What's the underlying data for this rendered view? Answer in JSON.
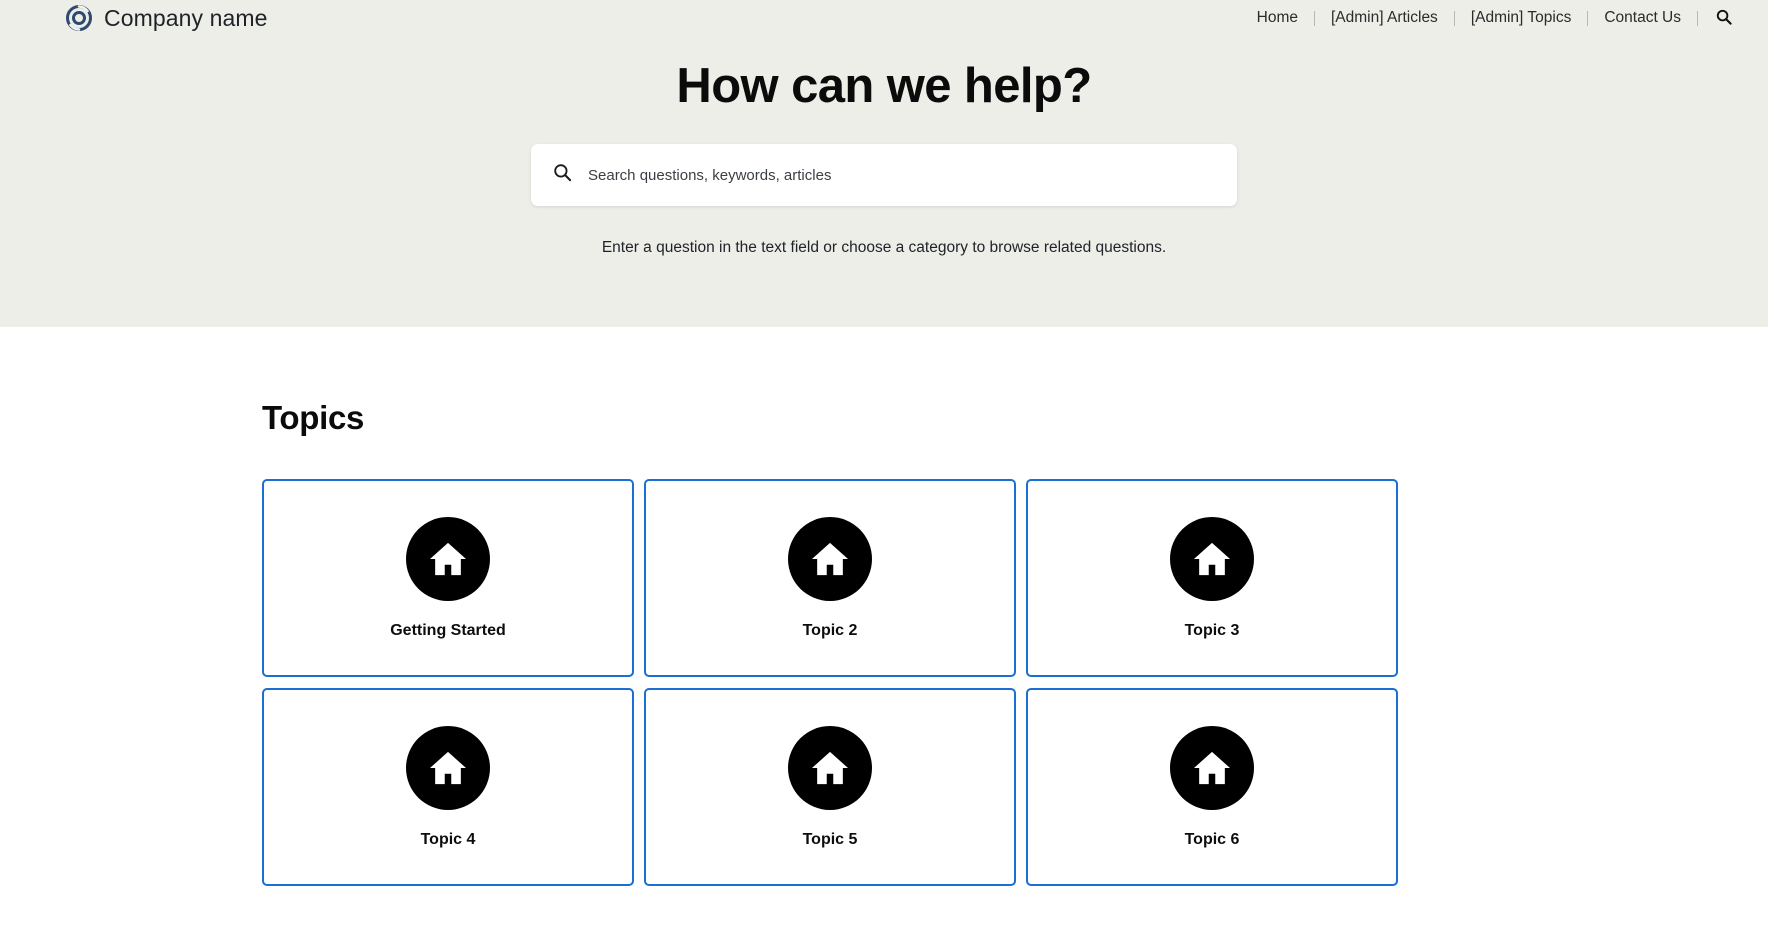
{
  "header": {
    "brand": {
      "logo_icon": "swirl-circle-logo",
      "name": "Company name",
      "logo_color": "#2e4a70"
    },
    "nav_items": [
      {
        "label": "Home"
      },
      {
        "label": "[Admin] Articles"
      },
      {
        "label": "[Admin] Topics"
      },
      {
        "label": "Contact Us"
      }
    ],
    "search_icon": "search-icon"
  },
  "hero": {
    "title": "How can we help?",
    "background_color": "#edeee8",
    "search": {
      "icon": "search-icon",
      "placeholder": "Search questions, keywords, articles",
      "value": ""
    },
    "subtext": "Enter a question in the text field or choose a category to browse related questions."
  },
  "topics": {
    "heading": "Topics",
    "card_border_color": "#1a6fd4",
    "cards": [
      {
        "label": "Getting Started",
        "icon": "home-icon"
      },
      {
        "label": "Topic 2",
        "icon": "home-icon"
      },
      {
        "label": "Topic 3",
        "icon": "home-icon"
      },
      {
        "label": "Topic 4",
        "icon": "home-icon"
      },
      {
        "label": "Topic 5",
        "icon": "home-icon"
      },
      {
        "label": "Topic 6",
        "icon": "home-icon"
      }
    ]
  }
}
